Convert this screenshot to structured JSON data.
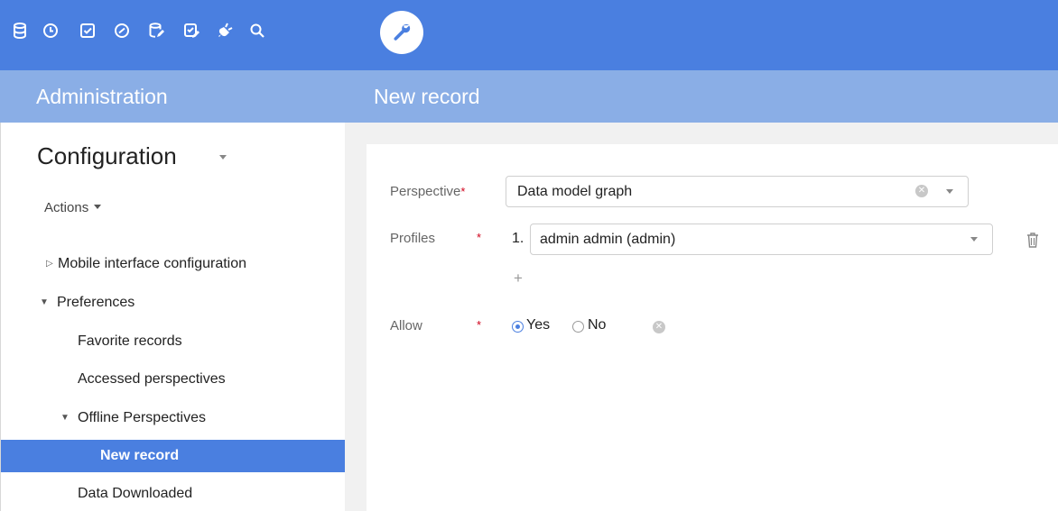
{
  "toolbar": {
    "tools": [
      {
        "icon": "database-icon",
        "active": false
      },
      {
        "icon": "clock-icon",
        "active": false
      },
      {
        "icon": "checkbox-icon",
        "active": false
      },
      {
        "icon": "gauge-icon",
        "active": false
      },
      {
        "icon": "database-edit-icon",
        "active": false
      },
      {
        "icon": "checklist-edit-icon",
        "active": false
      },
      {
        "icon": "plug-icon",
        "active": false
      },
      {
        "icon": "search-icon",
        "active": false
      },
      {
        "icon": "wrench-icon",
        "active": true
      }
    ],
    "colors": {
      "bar": "#4a7fe0",
      "active_bg": "#ffffff",
      "active_icon": "#4a7fe0"
    }
  },
  "header": {
    "section_title": "Administration",
    "page_title": "New record"
  },
  "sidebar": {
    "title": "Configuration",
    "actions_label": "Actions",
    "items": [
      {
        "label": "Mobile interface configuration",
        "expander": "collapsed"
      },
      {
        "label": "Preferences",
        "expander": "expanded"
      },
      {
        "label": "Favorite records",
        "expander": "none"
      },
      {
        "label": "Accessed perspectives",
        "expander": "none"
      },
      {
        "label": "Offline Perspectives",
        "expander": "expanded"
      },
      {
        "label": "New record",
        "expander": "none",
        "selected": true
      },
      {
        "label": "Data Downloaded",
        "expander": "none"
      }
    ]
  },
  "form": {
    "perspective": {
      "label": "Perspective",
      "value": "Data model graph"
    },
    "profiles": {
      "label": "Profiles",
      "index": "1.",
      "value": "admin admin (admin)"
    },
    "allow": {
      "label": "Allow",
      "yes_label": "Yes",
      "no_label": "No",
      "selected": "Yes"
    },
    "required_mark": "*"
  },
  "colors": {
    "accent": "#4a7fe0",
    "title_bar": "#8aaee6",
    "required": "#d0021b",
    "selected_row": "#4a7fe0"
  }
}
